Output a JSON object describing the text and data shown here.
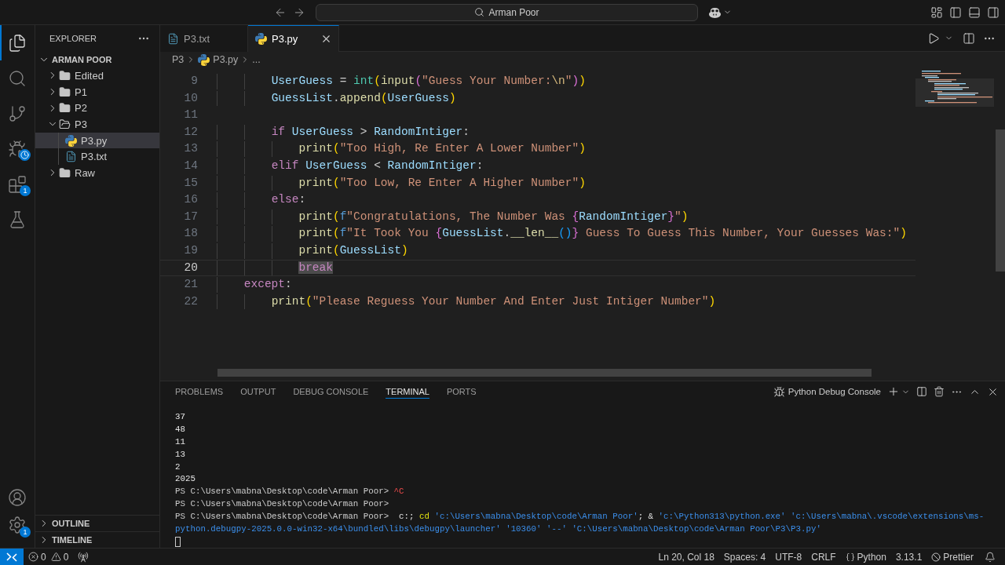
{
  "title_bar": {
    "command_center": "Arman Poor"
  },
  "activity_bar": {
    "items": [
      {
        "kind": "explorer",
        "selected": true,
        "busy": false
      },
      {
        "kind": "search",
        "selected": false,
        "busy": false
      },
      {
        "kind": "source_control",
        "selected": false,
        "busy": false
      },
      {
        "kind": "run_debug",
        "selected": false,
        "busy": true
      },
      {
        "kind": "extensions",
        "selected": false,
        "busy": false,
        "badge": "1"
      },
      {
        "kind": "testing",
        "selected": false,
        "busy": false
      }
    ],
    "bottom": [
      {
        "kind": "accounts"
      },
      {
        "kind": "manage",
        "badge": "1"
      }
    ]
  },
  "sidebar": {
    "title": "EXPLORER",
    "root": {
      "label": "ARMAN POOR",
      "expanded": true
    },
    "tree": [
      {
        "label": "Edited",
        "expanded": false,
        "selected": false
      },
      {
        "label": "P1",
        "expanded": false,
        "selected": false
      },
      {
        "label": "P2",
        "expanded": false,
        "selected": false
      },
      {
        "label": "P3",
        "expanded": true,
        "selected": false,
        "children": [
          {
            "label": "P3.py",
            "kind": "python",
            "selected": true
          },
          {
            "label": "P3.txt",
            "kind": "text",
            "selected": false
          }
        ]
      },
      {
        "label": "Raw",
        "expanded": false,
        "selected": false
      }
    ],
    "sections": [
      {
        "label": "OUTLINE",
        "expanded": false
      },
      {
        "label": "TIMELINE",
        "expanded": false
      }
    ]
  },
  "editor": {
    "tabs": [
      {
        "label": "P3.txt",
        "kind": "text",
        "selected": false
      },
      {
        "label": "P3.py",
        "kind": "python",
        "selected": true
      }
    ],
    "breadcrumbs": [
      {
        "label": "P3",
        "kind": "folder"
      },
      {
        "label": "P3.py",
        "kind": "python"
      },
      {
        "label": "...",
        "kind": "symbol"
      }
    ],
    "lines": [
      {
        "number": "9",
        "current": false,
        "tokens": [
          {
            "text": "        UserGuess",
            "kind": "var"
          },
          {
            "text": " = ",
            "kind": "op"
          },
          {
            "text": "int",
            "kind": "class"
          },
          {
            "text": "(",
            "kind": "b1"
          },
          {
            "text": "input",
            "kind": "func"
          },
          {
            "text": "(",
            "kind": "b2"
          },
          {
            "text": "\"Guess Your Number:",
            "kind": "str"
          },
          {
            "text": "\\n",
            "kind": "esc"
          },
          {
            "text": "\"",
            "kind": "str"
          },
          {
            "text": ")",
            "kind": "b2"
          },
          {
            "text": ")",
            "kind": "b1"
          }
        ]
      },
      {
        "number": "10",
        "current": false,
        "tokens": [
          {
            "text": "        GuessList",
            "kind": "var"
          },
          {
            "text": ".",
            "kind": "op"
          },
          {
            "text": "append",
            "kind": "func"
          },
          {
            "text": "(",
            "kind": "b1"
          },
          {
            "text": "UserGuess",
            "kind": "var"
          },
          {
            "text": ")",
            "kind": "b1"
          }
        ]
      },
      {
        "number": "11",
        "current": false
      },
      {
        "number": "12",
        "current": false,
        "tokens": [
          {
            "text": "        if ",
            "kind": "kw"
          },
          {
            "text": "UserGuess",
            "kind": "var"
          },
          {
            "text": " > ",
            "kind": "op"
          },
          {
            "text": "RandomIntiger",
            "kind": "var"
          },
          {
            "text": ":",
            "kind": "op"
          }
        ]
      },
      {
        "number": "13",
        "current": false,
        "tokens": [
          {
            "text": "            print",
            "kind": "func"
          },
          {
            "text": "(",
            "kind": "b1"
          },
          {
            "text": "\"Too High, Re Enter A Lower Number\"",
            "kind": "str"
          },
          {
            "text": ")",
            "kind": "b1"
          }
        ]
      },
      {
        "number": "14",
        "current": false,
        "tokens": [
          {
            "text": "        elif ",
            "kind": "kw"
          },
          {
            "text": "UserGuess",
            "kind": "var"
          },
          {
            "text": " < ",
            "kind": "op"
          },
          {
            "text": "RandomIntiger",
            "kind": "var"
          },
          {
            "text": ":",
            "kind": "op"
          }
        ]
      },
      {
        "number": "15",
        "current": false,
        "tokens": [
          {
            "text": "            print",
            "kind": "func"
          },
          {
            "text": "(",
            "kind": "b1"
          },
          {
            "text": "\"Too Low, Re Enter A Higher Number\"",
            "kind": "str"
          },
          {
            "text": ")",
            "kind": "b1"
          }
        ]
      },
      {
        "number": "16",
        "current": false,
        "tokens": [
          {
            "text": "        else",
            "kind": "kw"
          },
          {
            "text": ":",
            "kind": "op"
          }
        ]
      },
      {
        "number": "17",
        "current": false,
        "tokens": [
          {
            "text": "            print",
            "kind": "func"
          },
          {
            "text": "(",
            "kind": "b1"
          },
          {
            "text": "f",
            "kind": "fpre"
          },
          {
            "text": "\"Congratulations, The Number Was ",
            "kind": "str"
          },
          {
            "text": "{",
            "kind": "b2"
          },
          {
            "text": "RandomIntiger",
            "kind": "var"
          },
          {
            "text": "}",
            "kind": "b2"
          },
          {
            "text": "\"",
            "kind": "str"
          },
          {
            "text": ")",
            "kind": "b1"
          }
        ]
      },
      {
        "number": "18",
        "current": false,
        "tokens": [
          {
            "text": "            print",
            "kind": "func"
          },
          {
            "text": "(",
            "kind": "b1"
          },
          {
            "text": "f",
            "kind": "fpre"
          },
          {
            "text": "\"It Took You ",
            "kind": "str"
          },
          {
            "text": "{",
            "kind": "b2"
          },
          {
            "text": "GuessList",
            "kind": "var"
          },
          {
            "text": ".",
            "kind": "op"
          },
          {
            "text": "__len__",
            "kind": "func"
          },
          {
            "text": "(",
            "kind": "b3"
          },
          {
            "text": ")",
            "kind": "b3"
          },
          {
            "text": "}",
            "kind": "b2"
          },
          {
            "text": " Guess To Guess This Number, Your Guesses Was:\"",
            "kind": "str"
          },
          {
            "text": ")",
            "kind": "b1"
          }
        ]
      },
      {
        "number": "19",
        "current": false,
        "tokens": [
          {
            "text": "            print",
            "kind": "func"
          },
          {
            "text": "(",
            "kind": "b1"
          },
          {
            "text": "GuessList",
            "kind": "var"
          },
          {
            "text": ")",
            "kind": "b1"
          }
        ]
      },
      {
        "number": "20",
        "current": true,
        "tokens": [
          {
            "text": "            break",
            "kind": "kw_match"
          }
        ]
      },
      {
        "number": "21",
        "current": false,
        "tokens": [
          {
            "text": "    except",
            "kind": "kw"
          },
          {
            "text": ":",
            "kind": "op"
          }
        ]
      },
      {
        "number": "22",
        "current": false,
        "tokens": [
          {
            "text": "        print",
            "kind": "func"
          },
          {
            "text": "(",
            "kind": "b1"
          },
          {
            "text": "\"Please Reguess Your Number And Enter Just Intiger Number\"",
            "kind": "str"
          },
          {
            "text": ")",
            "kind": "b1"
          }
        ]
      }
    ]
  },
  "panel": {
    "tabs": [
      {
        "label": "PROBLEMS",
        "selected": false
      },
      {
        "label": "OUTPUT",
        "selected": false
      },
      {
        "label": "DEBUG CONSOLE",
        "selected": false
      },
      {
        "label": "TERMINAL",
        "selected": true
      },
      {
        "label": "PORTS",
        "selected": false
      }
    ],
    "terminal": "Python Debug Console",
    "lines": [
      {
        "segments": [
          {
            "text": "37",
            "kind": "output"
          }
        ]
      },
      {
        "segments": [
          {
            "text": "48",
            "kind": "output"
          }
        ]
      },
      {
        "segments": [
          {
            "text": "11",
            "kind": "output"
          }
        ]
      },
      {
        "segments": [
          {
            "text": "13",
            "kind": "output"
          }
        ]
      },
      {
        "segments": [
          {
            "text": "2",
            "kind": "output"
          }
        ]
      },
      {
        "segments": [
          {
            "text": "2025",
            "kind": "output"
          }
        ]
      },
      {
        "segments": [
          {
            "text": "PS C:\\Users\\mabna\\Desktop\\code\\Arman Poor> ",
            "kind": "prompt"
          },
          {
            "text": "^C",
            "kind": "error"
          }
        ]
      },
      {
        "segments": [
          {
            "text": "PS C:\\Users\\mabna\\Desktop\\code\\Arman Poor>",
            "kind": "prompt"
          }
        ]
      },
      {
        "segments": [
          {
            "text": "PS C:\\Users\\mabna\\Desktop\\code\\Arman Poor>  ",
            "kind": "prompt"
          },
          {
            "text": "c:; ",
            "kind": "command"
          },
          {
            "text": "cd ",
            "kind": "builtin"
          },
          {
            "text": "'c:\\Users\\mabna\\Desktop\\code\\Arman Poor'",
            "kind": "string"
          },
          {
            "text": "; & ",
            "kind": "command"
          },
          {
            "text": "'c:\\Python313\\python.exe' 'c:\\Users\\mabna\\.vscode\\extensions\\ms-",
            "kind": "string"
          }
        ]
      },
      {
        "segments": [
          {
            "text": "python.debugpy-2025.0.0-win32-x64\\bundled\\libs\\debugpy\\launcher' '10360' '--' 'C:\\Users\\mabna\\Desktop\\code\\Arman Poor\\P3\\P3.py'",
            "kind": "string"
          }
        ]
      }
    ]
  },
  "status_bar": {
    "errors": "0",
    "warnings": "0",
    "items": [
      {
        "kind": "text",
        "label": "Ln 20, Col 18"
      },
      {
        "kind": "text",
        "label": "Spaces: 4"
      },
      {
        "kind": "text",
        "label": "UTF-8"
      },
      {
        "kind": "text",
        "label": "CRLF"
      },
      {
        "kind": "language",
        "label": "Python"
      },
      {
        "kind": "text",
        "label": "3.13.1"
      },
      {
        "kind": "formatter",
        "label": "Prettier"
      }
    ]
  }
}
